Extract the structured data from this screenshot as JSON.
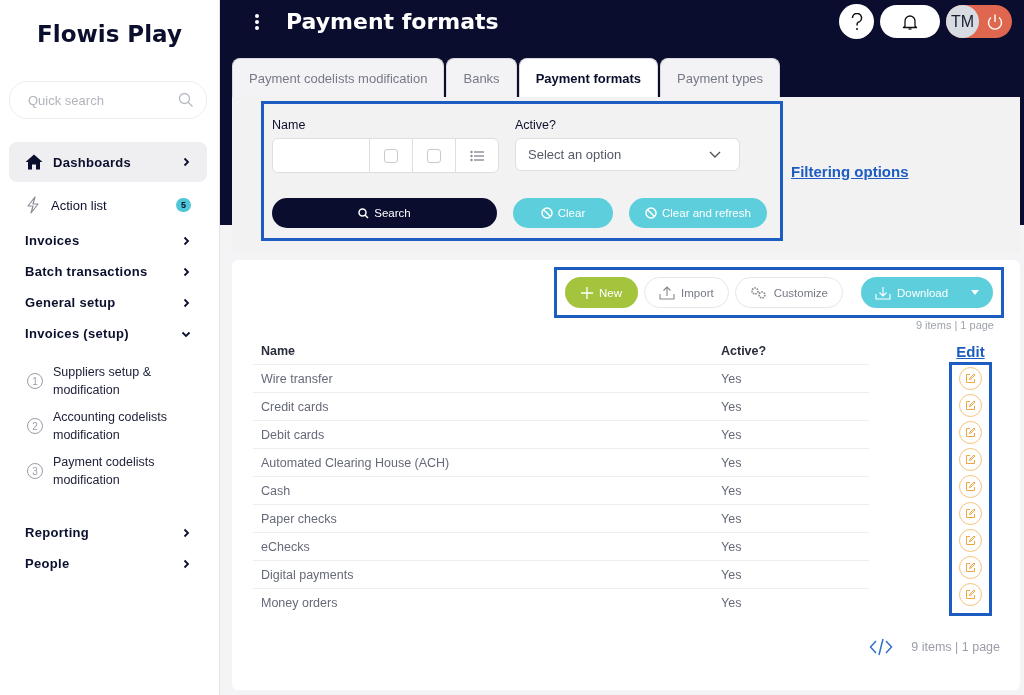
{
  "app": {
    "name": "Flowis Play"
  },
  "sidebar": {
    "search": {
      "placeholder": "Quick search"
    },
    "items": [
      {
        "kind": "home",
        "label": "Dashboards",
        "selected": true,
        "expanded": false
      },
      {
        "kind": "action",
        "label": "Action list",
        "badge": "5",
        "selected": false
      },
      {
        "kind": "group",
        "label": "Invoices",
        "selected": false,
        "expanded": false
      },
      {
        "kind": "group",
        "label": "Batch transactions",
        "selected": false,
        "expanded": false
      },
      {
        "kind": "group",
        "label": "General setup",
        "selected": false,
        "expanded": false
      },
      {
        "kind": "group",
        "label": "Invoices (setup)",
        "selected": false,
        "expanded": true,
        "children": [
          {
            "number": "1",
            "label": "Suppliers setup & modification",
            "selected": false
          },
          {
            "number": "2",
            "label": "Accounting codelists modification",
            "selected": false
          },
          {
            "number": "3",
            "label": "Payment codelists modification",
            "selected": false
          }
        ]
      },
      {
        "kind": "group",
        "label": "Reporting",
        "selected": false,
        "expanded": false
      },
      {
        "kind": "group",
        "label": "People",
        "selected": false,
        "expanded": false
      }
    ]
  },
  "header": {
    "title": "Payment formats",
    "avatar": "TM"
  },
  "tabs": [
    {
      "label": "Payment codelists modification",
      "selected": false
    },
    {
      "label": "Banks",
      "selected": false
    },
    {
      "label": "Payment formats",
      "selected": true
    },
    {
      "label": "Payment types",
      "selected": false
    }
  ],
  "filter": {
    "name_label": "Name",
    "name_options": [
      {
        "checked": false
      },
      {
        "checked": false
      }
    ],
    "active_label": "Active?",
    "active_placeholder": "Select an option",
    "buttons": [
      {
        "kind": "primary",
        "label": "Search"
      },
      {
        "kind": "clear",
        "label": "Clear"
      },
      {
        "kind": "clear",
        "label": "Clear and refresh"
      }
    ]
  },
  "annotations": {
    "filter": "Filtering options",
    "edit": "Edit"
  },
  "toolbar": [
    {
      "kind": "new",
      "label": "New"
    },
    {
      "kind": "import",
      "label": "Import"
    },
    {
      "kind": "customize",
      "label": "Customize"
    },
    {
      "kind": "download",
      "label": "Download"
    }
  ],
  "pagination_top": "9 items | 1 page",
  "table": {
    "columns": [
      "Name",
      "Active?"
    ],
    "rows": [
      {
        "name": "Wire transfer",
        "active": "Yes"
      },
      {
        "name": "Credit cards",
        "active": "Yes"
      },
      {
        "name": "Debit cards",
        "active": "Yes"
      },
      {
        "name": "Automated Clearing House (ACH)",
        "active": "Yes"
      },
      {
        "name": "Cash",
        "active": "Yes"
      },
      {
        "name": "Paper checks",
        "active": "Yes"
      },
      {
        "name": "eChecks",
        "active": "Yes"
      },
      {
        "name": "Digital payments",
        "active": "Yes"
      },
      {
        "name": "Money orders",
        "active": "Yes"
      }
    ]
  },
  "pagination_bottom": "9 items | 1 page"
}
